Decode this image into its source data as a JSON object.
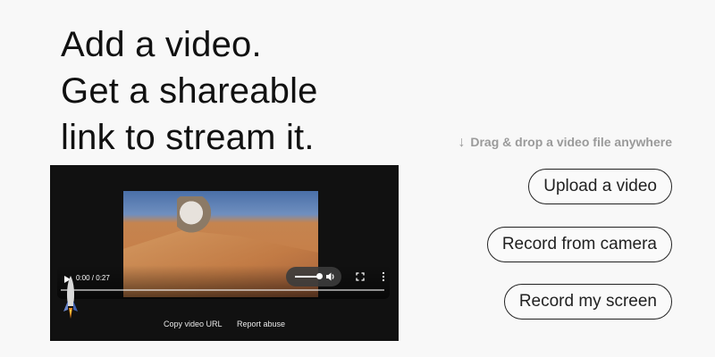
{
  "headline": {
    "lines": [
      "Add a video.",
      "Get a shareable",
      "link to stream it."
    ]
  },
  "drag_hint": {
    "arrow": "↓",
    "text": "Drag & drop a video file anywhere"
  },
  "actions": {
    "upload_label": "Upload a video",
    "camera_label": "Record from camera",
    "screen_label": "Record my screen"
  },
  "player": {
    "time": "0:00 / 0:27",
    "progress": 0,
    "volume_level": 0.85,
    "icons": {
      "play": "play-icon",
      "volume": "volume-icon",
      "fullscreen": "fullscreen-icon",
      "more": "more-vertical-icon",
      "mascot": "rocket-mascot-icon"
    },
    "links": {
      "copy_url": "Copy video URL",
      "report": "Report abuse"
    }
  },
  "colors": {
    "background": "#f8f8f8",
    "text": "#111111",
    "hint": "#9a9a9a",
    "player_bg": "#111111"
  }
}
